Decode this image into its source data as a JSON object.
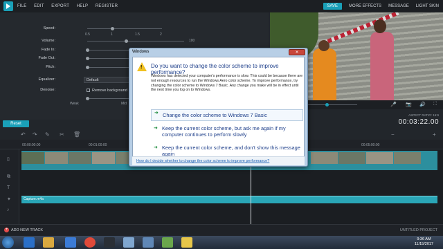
{
  "menu": {
    "left": [
      "FILE",
      "EDIT",
      "EXPORT",
      "HELP",
      "REGISTER"
    ],
    "save": "SAVE",
    "right": [
      "MORE EFFECTS",
      "MESSAGE",
      "LIGHT SKIN"
    ]
  },
  "settings": {
    "speed_label": "Speed:",
    "speed_ticks": [
      "0.5",
      "1",
      "1.5",
      "2"
    ],
    "volume_label": "Volume:",
    "volume_max": "100",
    "fadein_label": "Fade In:",
    "fadeout_label": "Fade Out:",
    "pitch_label": "Pitch:",
    "equalizer_label": "Equalizer:",
    "equalizer_value": "Default",
    "denoise_label": "Denoise:",
    "denoise_option": "Remove background",
    "weak_label": "Weak",
    "mid_label": "Mid",
    "reset": "Reset"
  },
  "preview": {
    "aspect": "ASPECT RATIO: 16:9",
    "timecode": "00:03:22.00"
  },
  "timeline": {
    "ruler": [
      "00:00:00:00",
      "00:01:00:00",
      "00:05:00:00"
    ],
    "audio_clip": "Capture.m4a",
    "add_track": "ADD NEW TRACK",
    "project": "UNTITLED PROJECT"
  },
  "dialog": {
    "title": "Windows",
    "close": "✕",
    "heading": "Do you want to change the color scheme to improve performance?",
    "text": "Windows has detected your computer's performance is slow. This could be because there are not enough resources to run the Windows Aero color scheme. To improve performance, try changing the color scheme to Windows 7 Basic. Any change you make will be in effect until the next time you log on to Windows.",
    "option1": "Change the color scheme to Windows 7 Basic",
    "option2": "Keep the current color scheme, but ask me again if my computer continues to perform slowly",
    "option3": "Keep the current color scheme, and don't show this message again",
    "link": "How do I decide whether to change the color scheme to improve performance?"
  },
  "taskbar": {
    "time": "9:36 AM",
    "date": "11/15/2017"
  }
}
